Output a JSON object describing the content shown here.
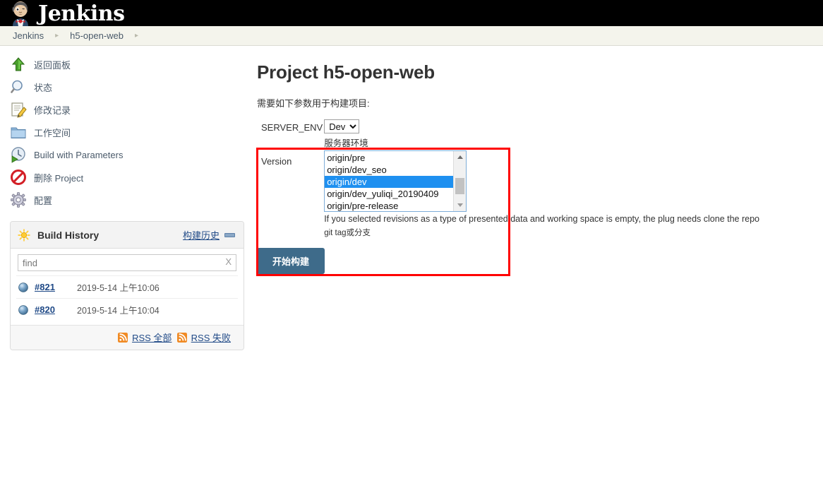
{
  "header": {
    "brand": "Jenkins",
    "mascot_icon": "jenkins-butler-icon"
  },
  "breadcrumb": {
    "items": [
      {
        "label": "Jenkins"
      },
      {
        "label": "h5-open-web"
      }
    ],
    "separator": "▸"
  },
  "sidebar": {
    "tasks": [
      {
        "label": "返回面板",
        "icon": "up-arrow-icon",
        "name": "back-to-dashboard"
      },
      {
        "label": "状态",
        "icon": "magnifier-icon",
        "name": "status"
      },
      {
        "label": "修改记录",
        "icon": "notepad-pencil-icon",
        "name": "changes"
      },
      {
        "label": "工作空间",
        "icon": "folder-icon",
        "name": "workspace"
      },
      {
        "label": "Build with Parameters",
        "icon": "clock-play-icon",
        "name": "build-with-parameters"
      },
      {
        "label": "删除 Project",
        "icon": "no-entry-icon",
        "name": "delete-project"
      },
      {
        "label": "配置",
        "icon": "gear-icon",
        "name": "configure"
      }
    ]
  },
  "build_history": {
    "title": "Build History",
    "sun_icon": "sun-icon",
    "trend_link": "构建历史",
    "collapse_icon": "collapse-icon",
    "find_placeholder": "find",
    "find_value": "",
    "clear_label": "X",
    "builds": [
      {
        "number": "#821",
        "date": "2019-5-14 上午10:06",
        "status_icon": "blue-ball-icon"
      },
      {
        "number": "#820",
        "date": "2019-5-14 上午10:04",
        "status_icon": "blue-ball-icon"
      }
    ],
    "rss_all": "RSS 全部",
    "rss_failed": "RSS 失败",
    "rss_icon": "rss-icon"
  },
  "main": {
    "project_title": "Project h5-open-web",
    "params_intro": "需要如下参数用于构建项目:",
    "build_button": "开始构建",
    "parameters": [
      {
        "name": "SERVER_ENV",
        "type": "select",
        "value": "Dev",
        "options": [
          "Dev"
        ],
        "description": "服务器环境"
      },
      {
        "name": "Version",
        "type": "listbox",
        "options": [
          "origin/pre",
          "origin/dev_seo",
          "origin/dev",
          "origin/dev_yuliqi_20190409",
          "origin/pre-release"
        ],
        "selected": "origin/dev",
        "description": "If you selected revisions as a type of presented data and working space is empty, the plug needs clone the repo",
        "description2": "git tag或分支"
      }
    ]
  },
  "annotation": {
    "highlight_color": "#ff0000"
  }
}
